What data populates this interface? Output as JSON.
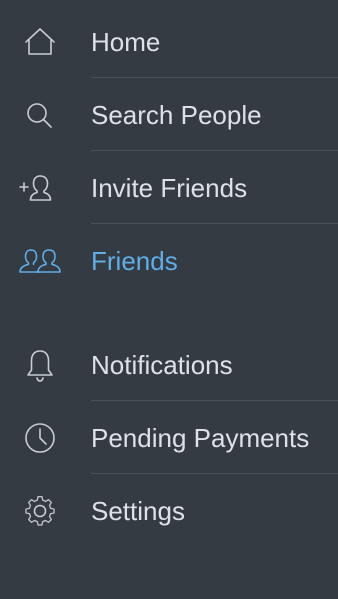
{
  "menu": {
    "accent_color": "#5eaee8",
    "text_color": "#dde2e8",
    "background_color": "#353b43",
    "items": [
      {
        "label": "Home",
        "icon": "home-icon",
        "active": false
      },
      {
        "label": "Search People",
        "icon": "search-icon",
        "active": false
      },
      {
        "label": "Invite Friends",
        "icon": "add-person-icon",
        "active": false
      },
      {
        "label": "Friends",
        "icon": "friends-icon",
        "active": true
      },
      {
        "label": "Notifications",
        "icon": "bell-icon",
        "active": false
      },
      {
        "label": "Pending Payments",
        "icon": "clock-icon",
        "active": false
      },
      {
        "label": "Settings",
        "icon": "gear-icon",
        "active": false
      }
    ]
  }
}
